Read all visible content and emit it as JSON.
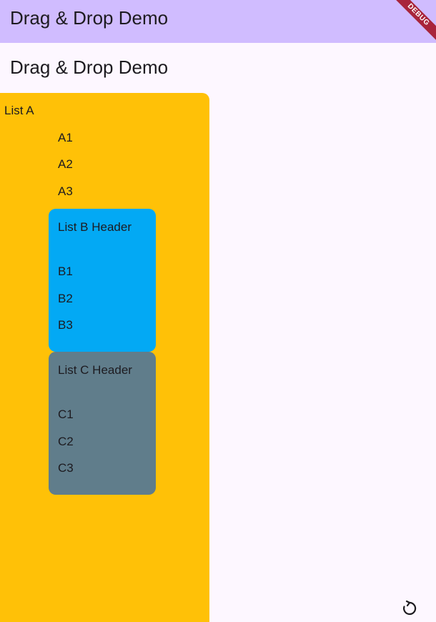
{
  "appbar": {
    "title": "Drag & Drop Demo",
    "debug_label": "DEBUG"
  },
  "page": {
    "title": "Drag & Drop Demo"
  },
  "list_a": {
    "title": "List A",
    "items": [
      "A1",
      "A2",
      "A3"
    ],
    "color": "#ffc107"
  },
  "list_b": {
    "header": "List B Header",
    "items": [
      "B1",
      "B2",
      "B3"
    ],
    "color": "#03a9f4"
  },
  "list_c": {
    "header": "List C Header",
    "items": [
      "C1",
      "C2",
      "C3"
    ],
    "color": "#607d8b"
  },
  "colors": {
    "appbar": "#d0bcff",
    "background": "#fdf7ff",
    "debug": "#a8243b"
  },
  "icons": {
    "refresh": "refresh-icon"
  }
}
